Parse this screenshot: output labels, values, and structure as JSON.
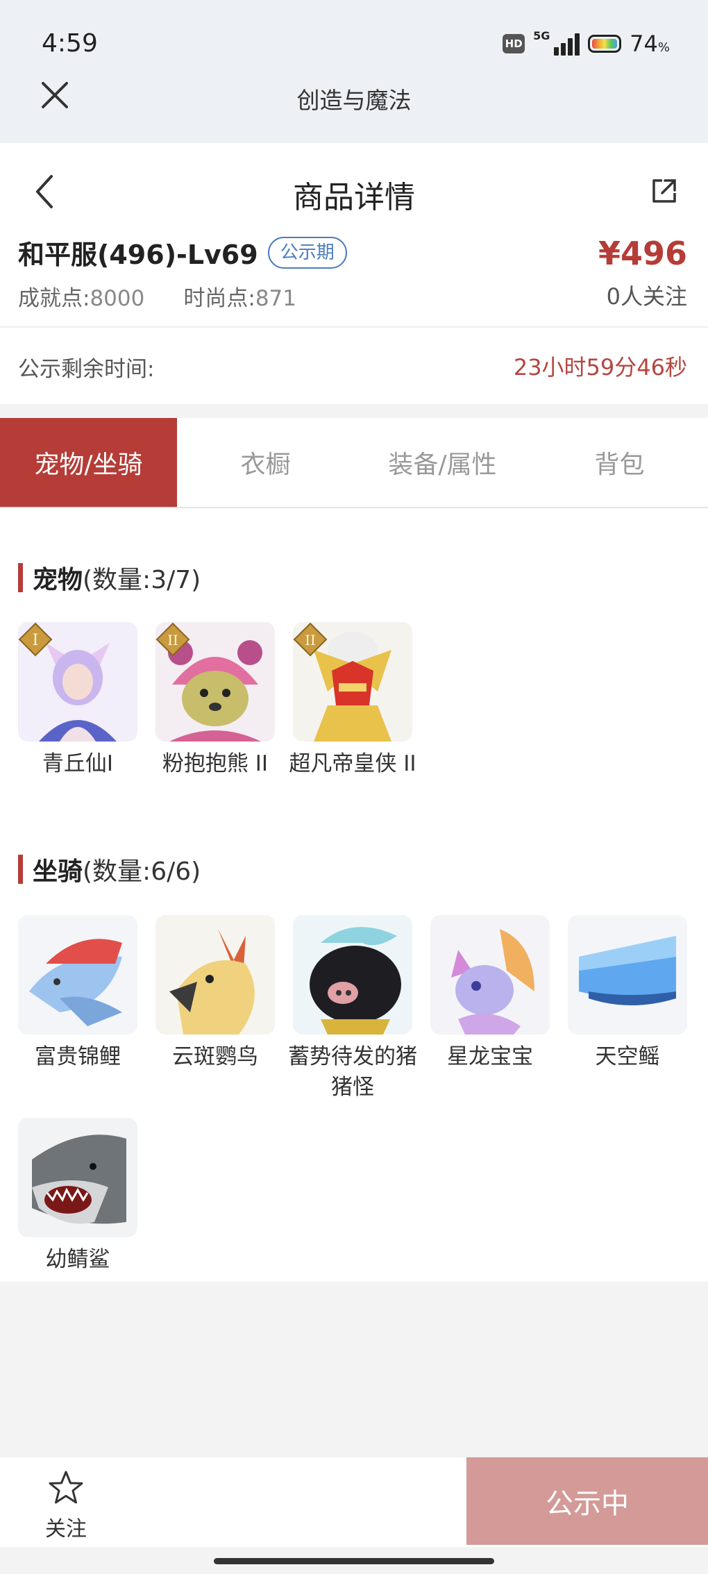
{
  "status": {
    "time": "4:59",
    "hd": "HD",
    "network": "5G",
    "battery": "74",
    "battery_unit": "%"
  },
  "appbar": {
    "title": "创造与魔法"
  },
  "detail": {
    "title": "商品详情",
    "product_name": "和平服(496)-Lv69",
    "phase_badge": "公示期",
    "price": "¥496",
    "achievement_label": "成就点:",
    "achievement_value": "8000",
    "fashion_label": "时尚点:",
    "fashion_value": "871",
    "followers": "0人关注"
  },
  "timer": {
    "label": "公示剩余时间:",
    "value": "23小时59分46秒"
  },
  "tabs": [
    {
      "label": "宠物/坐骑",
      "active": true
    },
    {
      "label": "衣橱",
      "active": false
    },
    {
      "label": "装备/属性",
      "active": false
    },
    {
      "label": "背包",
      "active": false
    }
  ],
  "pets": {
    "title": "宠物",
    "count": "(数量:3/7)",
    "items": [
      {
        "name": "青丘仙I",
        "rank": "I"
      },
      {
        "name": "粉抱抱熊 II",
        "rank": "II"
      },
      {
        "name": "超凡帝皇侠 II",
        "rank": "II"
      }
    ]
  },
  "mounts": {
    "title": "坐骑",
    "count": "(数量:6/6)",
    "items": [
      {
        "name": "富贵锦鲤"
      },
      {
        "name": "云斑鹦鸟"
      },
      {
        "name": "蓄势待发的猪猪怪"
      },
      {
        "name": "星龙宝宝"
      },
      {
        "name": "天空鳐"
      },
      {
        "name": "幼鲭鲨"
      }
    ]
  },
  "bottom": {
    "follow_label": "关注",
    "cta_label": "公示中"
  },
  "colors": {
    "accent": "#b53c37",
    "cta": "#d39a98",
    "badge": "#4a7cc0"
  }
}
